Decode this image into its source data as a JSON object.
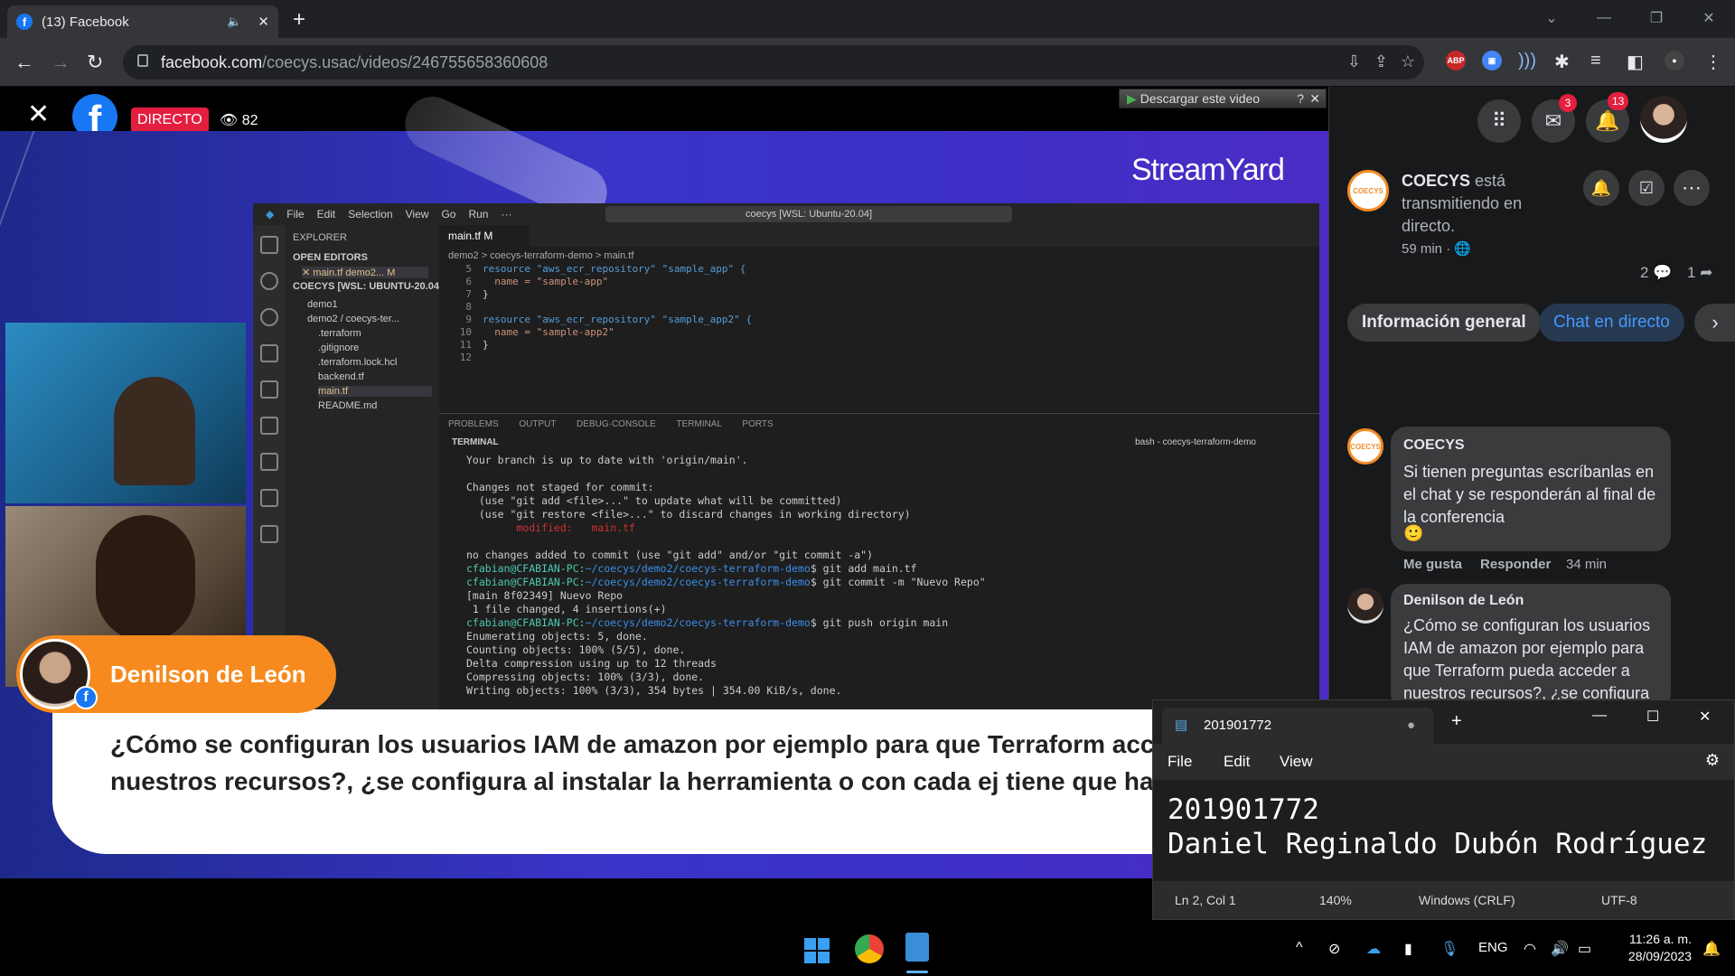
{
  "browser": {
    "tab_title": "(13) Facebook",
    "tab_favicon": "f",
    "new_tab": "+",
    "url_domain": "facebook.com",
    "url_path": "/coecys.usac/videos/246755658360608",
    "extensions": [
      "ABP"
    ]
  },
  "video": {
    "live_label": "DIRECTO",
    "viewer_count": "82",
    "download_button": "Descargar este video",
    "fb_logo": "f",
    "brand": "StreamYard",
    "speaker_name": "Denilson de León",
    "question": "¿Cómo se configuran los usuarios IAM de amazon por ejemplo para que Terraform acceder a nuestros recursos?, ¿se configura al instalar la herramienta o con cada ej tiene que hacer?"
  },
  "vscode": {
    "menu": [
      "File",
      "Edit",
      "Selection",
      "View",
      "Go",
      "Run",
      "···"
    ],
    "search": "coecys [WSL: Ubuntu-20.04]",
    "explorer": [
      "EXPLORER",
      "OPEN EDITORS",
      "✕ main.tf demo2... M",
      "COECYS [WSL: UBUNTU-20.04]",
      "demo1",
      "demo2 / coecys-ter...",
      ".terraform",
      ".gitignore",
      ".terraform.lock.hcl",
      "backend.tf",
      "main.tf",
      "README.md"
    ],
    "tab": "main.tf M",
    "breadcrumb": "demo2 > coecys-terraform-demo > main.tf",
    "code_lines": [
      {
        "n": "5",
        "t": "resource \"aws_ecr_repository\" \"sample_app\" {"
      },
      {
        "n": "6",
        "t": "  name = \"sample-app\""
      },
      {
        "n": "7",
        "t": "}"
      },
      {
        "n": "8",
        "t": ""
      },
      {
        "n": "9",
        "t": "resource \"aws_ecr_repository\" \"sample_app2\" {"
      },
      {
        "n": "10",
        "t": "  name = \"sample-app2\""
      },
      {
        "n": "11",
        "t": "}"
      },
      {
        "n": "12",
        "t": ""
      }
    ],
    "panel_tabs": "PROBLEMS OUTPUT DEBUG·CONSOLE TERMINAL PORTS",
    "terminal_label": "TERMINAL",
    "terminal_shell": "bash - coecys-terraform-demo",
    "terminal_lines": [
      "Your branch is up to date with 'origin/main'.",
      "",
      "Changes not staged for commit:",
      "  (use \"git add <file>...\" to update what will be committed)",
      "  (use \"git restore <file>...\" to discard changes in working directory)",
      "        modified:   main.tf",
      "",
      "no changes added to commit (use \"git add\" and/or \"git commit -a\")",
      "cfabian@CFABIAN-PC:~/coecys/demo2/coecys-terraform-demo$ git add main.tf",
      "cfabian@CFABIAN-PC:~/coecys/demo2/coecys-terraform-demo$ git commit -m \"Nuevo Repo\"",
      "[main 8f02349] Nuevo Repo",
      " 1 file changed, 4 insertions(+)",
      "cfabian@CFABIAN-PC:~/coecys/demo2/coecys-terraform-demo$ git push origin main",
      "Enumerating objects: 5, done.",
      "Counting objects: 100% (5/5), done.",
      "Delta compression using up to 12 threads",
      "Compressing objects: 100% (3/3), done.",
      "Writing objects: 100% (3/3), 354 bytes | 354.00 KiB/s, done."
    ]
  },
  "sidebar": {
    "messenger_badge": "3",
    "notif_badge": "13",
    "page_name": "COECYS",
    "status_line1": "está",
    "status_line2": "transmitiendo en",
    "status_line3": "directo.",
    "time": "59 min · 🌐",
    "comments_count": "2",
    "shares_count": "1",
    "tab_info": "Información general",
    "tab_chat": "Chat en directo",
    "comment1": {
      "author": "COECYS",
      "text": "Si tienen preguntas escríbanlas en el chat y se responderán al final de la conferencia",
      "emoji": "🙂",
      "like": "Me gusta",
      "reply": "Responder",
      "time": "34 min"
    },
    "comment2": {
      "author": "Denilson de León",
      "text": "¿Cómo se configuran los usuarios IAM de amazon por ejemplo para que Terraform pueda acceder a nuestros recursos?, ¿se configura"
    }
  },
  "notepad": {
    "tab_title": "201901772",
    "menu": [
      "File",
      "Edit",
      "View"
    ],
    "line1": "201901772",
    "line2": "Daniel Reginaldo Dubón Rodríguez",
    "status_pos": "Ln 2, Col 1",
    "status_zoom": "140%",
    "status_eol": "Windows (CRLF)",
    "status_enc": "UTF-8"
  },
  "taskbar": {
    "lang": "ENG",
    "time": "11:26 a. m.",
    "date": "28/09/2023"
  },
  "colors": {
    "fb_blue": "#1877f2",
    "live_red": "#e41e3f",
    "nameplate_orange": "#f68a1e",
    "stage_purple": "#3a34c8"
  }
}
